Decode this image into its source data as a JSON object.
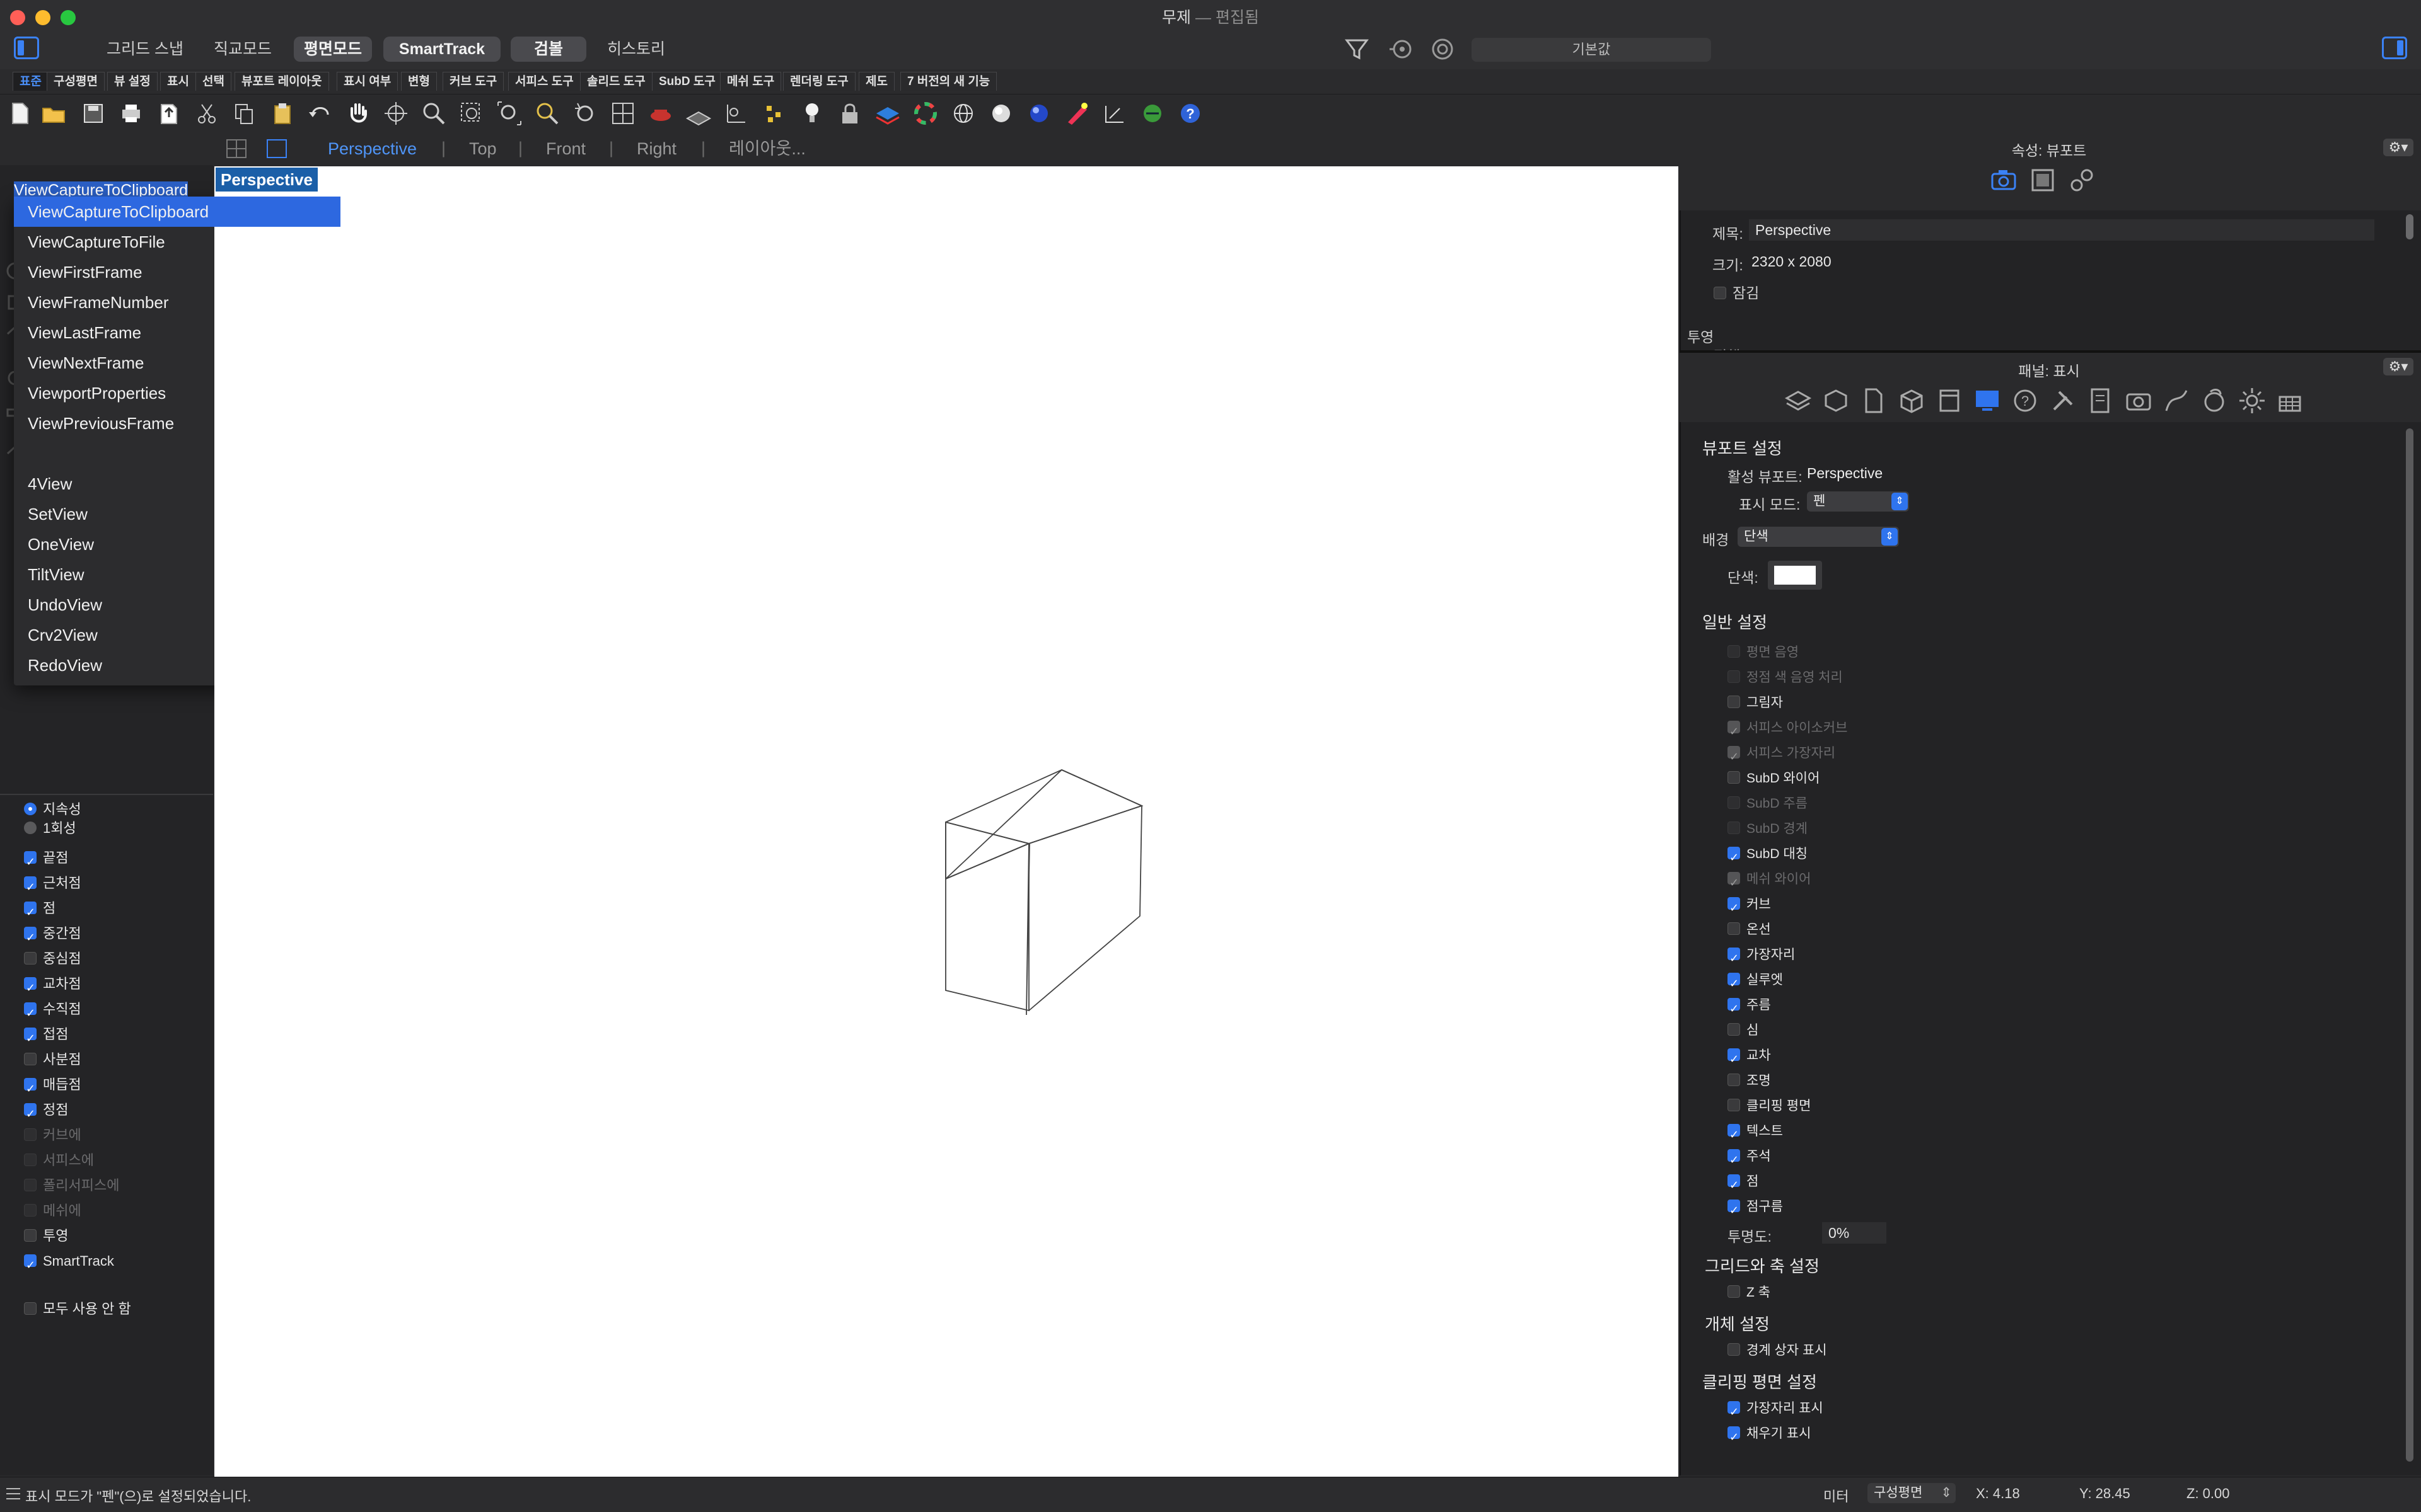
{
  "window": {
    "title": "무제",
    "title_sep": " — ",
    "title_status": "편집됨",
    "mode_buttons": [
      "그리드 스냅",
      "직교모드",
      "평면모드",
      "SmartTrack",
      "검볼",
      "히스토리"
    ],
    "mode_active": [
      false,
      false,
      true,
      true,
      true,
      false
    ],
    "command_placeholder": "기본값"
  },
  "tabs": [
    "표준",
    "구성평면",
    "뷰 설정",
    "표시",
    "선택",
    "뷰포트 레이아웃",
    "표시 여부",
    "변형",
    "커브 도구",
    "서피스 도구",
    "솔리드 도구",
    "SubD 도구",
    "메쉬 도구",
    "렌더링 도구",
    "제도",
    "7 버전의 새 기능"
  ],
  "active_tab": 0,
  "viewport_tabs": [
    "Perspective",
    "Top",
    "Front",
    "Right",
    "레이아웃..."
  ],
  "active_viewport_tab": 0,
  "viewport_label": "Perspective",
  "command": {
    "typed": "ViewCaptureToClipboard",
    "suggestions_group1": [
      "ViewCaptureToClipboard",
      "ViewCaptureToFile",
      "ViewFirstFrame",
      "ViewFrameNumber",
      "ViewLastFrame",
      "ViewNextFrame",
      "ViewportProperties",
      "ViewPreviousFrame"
    ],
    "suggestions_group2": [
      "4View",
      "SetView",
      "OneView",
      "TiltView",
      "UndoView",
      "Crv2View",
      "RedoView"
    ],
    "selected_index": 0
  },
  "osnap": {
    "radio": [
      {
        "label": "지속성",
        "on": true
      },
      {
        "label": "1회성",
        "on": false
      }
    ],
    "items": [
      {
        "label": "끝점",
        "state": "on"
      },
      {
        "label": "근처점",
        "state": "on"
      },
      {
        "label": "점",
        "state": "on"
      },
      {
        "label": "중간점",
        "state": "on"
      },
      {
        "label": "중심점",
        "state": "off"
      },
      {
        "label": "교차점",
        "state": "on"
      },
      {
        "label": "수직점",
        "state": "on"
      },
      {
        "label": "접점",
        "state": "on"
      },
      {
        "label": "사분점",
        "state": "off"
      },
      {
        "label": "매듭점",
        "state": "on"
      },
      {
        "label": "정점",
        "state": "on"
      },
      {
        "label": "커브에",
        "state": "dim"
      },
      {
        "label": "서피스에",
        "state": "dim"
      },
      {
        "label": "폴리서피스에",
        "state": "dim"
      },
      {
        "label": "메쉬에",
        "state": "dim"
      },
      {
        "label": "투영",
        "state": "off"
      },
      {
        "label": "SmartTrack",
        "state": "on"
      }
    ],
    "disable_all": "모두 사용 안 함"
  },
  "properties": {
    "header": "속성: 뷰포트",
    "title_label": "제목:",
    "title_value": "Perspective",
    "size_label": "크기:",
    "size_value": "2320 x 2080",
    "lock_label": "잠김",
    "projection_label": "투영",
    "projection_partial": "평행"
  },
  "panel": {
    "header": "패널: 표시",
    "viewport_settings": "뷰포트 설정",
    "active_viewport_label": "활성 뷰포트:",
    "active_viewport_value": "Perspective",
    "display_mode_label": "표시 모드:",
    "display_mode_value": "펜",
    "background_label": "배경",
    "background_value": "단색",
    "solid_color_label": "단색:",
    "general_settings": "일반 설정",
    "general_items": [
      {
        "label": "평면 음영",
        "state": "dim"
      },
      {
        "label": "정점 색 음영 처리",
        "state": "dim"
      },
      {
        "label": "그림자",
        "state": "off"
      },
      {
        "label": "서피스 아이소커브",
        "state": "dimon"
      },
      {
        "label": "서피스 가장자리",
        "state": "dimon"
      },
      {
        "label": "SubD 와이어",
        "state": "off"
      },
      {
        "label": "SubD 주름",
        "state": "dim"
      },
      {
        "label": "SubD 경계",
        "state": "dim"
      },
      {
        "label": "SubD 대칭",
        "state": "on"
      },
      {
        "label": "메쉬 와이어",
        "state": "dimon"
      },
      {
        "label": "커브",
        "state": "on"
      },
      {
        "label": "온선",
        "state": "off"
      },
      {
        "label": "가장자리",
        "state": "on"
      },
      {
        "label": "실루엣",
        "state": "on"
      },
      {
        "label": "주름",
        "state": "on"
      },
      {
        "label": "심",
        "state": "off"
      },
      {
        "label": "교차",
        "state": "on"
      },
      {
        "label": "조명",
        "state": "off"
      },
      {
        "label": "클리핑 평면",
        "state": "off"
      },
      {
        "label": "텍스트",
        "state": "on"
      },
      {
        "label": "주석",
        "state": "on"
      },
      {
        "label": "점",
        "state": "on"
      },
      {
        "label": "점구름",
        "state": "on"
      }
    ],
    "transparency_label": "투명도:",
    "transparency_value": "0%",
    "grid_axes": "그리드와 축 설정",
    "z_axis": "Z 축",
    "object_settings": "개체 설정",
    "bbox_display": "경계 상자 표시",
    "clipping_settings": "클리핑 평면 설정",
    "clip_edges": "가장자리 표시",
    "clip_fill": "채우기 표시"
  },
  "status": {
    "message": "표시 모드가 \"펜\"(으)로 설정되었습니다.",
    "unit": "미터",
    "cplane": "구성평면",
    "x": "X: 4.18",
    "y": "Y: 28.45",
    "z": "Z: 0.00"
  },
  "colors": {
    "accent": "#2f74ee",
    "viewport_bg": "#ffffff",
    "panel_bg": "#232325"
  }
}
